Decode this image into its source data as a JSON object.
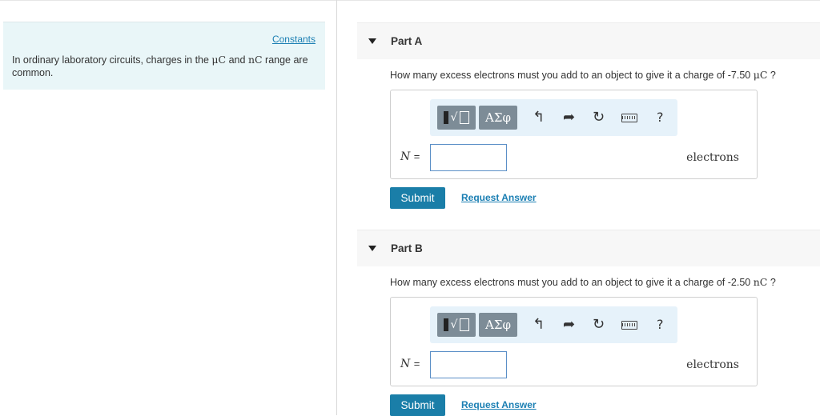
{
  "sidebar": {
    "constants_link": "Constants",
    "intro_pre": "In ordinary laboratory circuits, charges in the ",
    "unit_micro": "μC",
    "intro_mid": " and ",
    "unit_nano": "nC",
    "intro_post": " range are common."
  },
  "parts": [
    {
      "title": "Part A",
      "question_pre": "How many excess electrons must you add to an object to give it a charge of -7.50 ",
      "question_unit": "μC",
      "question_post": " ?",
      "toolbar": {
        "template_icon": "template-radical-icon",
        "greek_label": "ΑΣφ",
        "undo_glyph": "↰",
        "redo_glyph": "➦",
        "reset_glyph": "↻",
        "keyboard_icon": "keyboard-icon",
        "help_label": "?"
      },
      "var_label": "N",
      "equals": "=",
      "input_value": "",
      "unit_label": "electrons",
      "submit_label": "Submit",
      "request_label": "Request Answer"
    },
    {
      "title": "Part B",
      "question_pre": "How many excess electrons must you add to an object to give it a charge of -2.50 ",
      "question_unit": "nC",
      "question_post": " ?",
      "toolbar": {
        "template_icon": "template-radical-icon",
        "greek_label": "ΑΣφ",
        "undo_glyph": "↰",
        "redo_glyph": "➦",
        "reset_glyph": "↻",
        "keyboard_icon": "keyboard-icon",
        "help_label": "?"
      },
      "var_label": "N",
      "equals": "=",
      "input_value": "",
      "unit_label": "electrons",
      "submit_label": "Submit",
      "request_label": "Request Answer"
    }
  ],
  "colors": {
    "accent": "#1a7ea8",
    "link": "#1b7fb3",
    "sidebar_bg": "#e9f6f8",
    "toolbar_bg": "#e6f2fa"
  }
}
